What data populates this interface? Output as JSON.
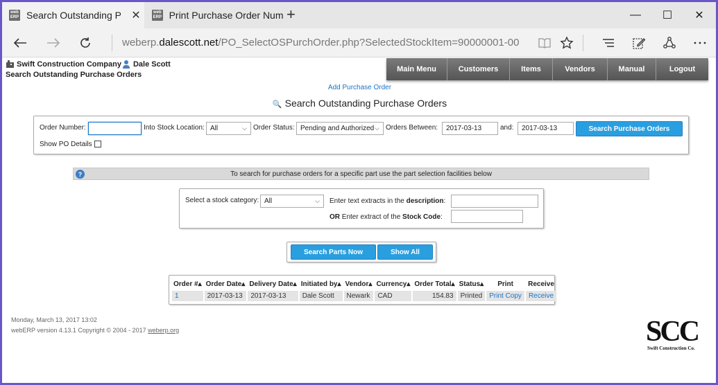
{
  "browser": {
    "tabs": [
      {
        "favicon": "web ERP",
        "title": "Search Outstanding Pur",
        "close": "✕",
        "active": true
      },
      {
        "favicon": "web ERP",
        "title": "Print Purchase Order Numb",
        "close": "",
        "active": false
      }
    ],
    "new_tab": "+",
    "window_controls": {
      "minimize": "—",
      "maximize": "☐",
      "close": "✕"
    },
    "address": {
      "prefix": "weberp.",
      "host": "dalescott.net",
      "path": "/PO_SelectOSPurchOrder.php?SelectedStockItem=90000001-00"
    },
    "nav_icons": {
      "back": "arrow-left-icon",
      "forward": "arrow-right-icon",
      "refresh": "refresh-icon"
    }
  },
  "header": {
    "company": "Swift Construction Company",
    "user": "Dale Scott",
    "subtitle": "Search Outstanding Purchase Orders"
  },
  "menu": [
    "Main Menu",
    "Customers",
    "Items",
    "Vendors",
    "Manual",
    "Logout"
  ],
  "add_po_link": "Add Purchase Order",
  "page_title": "Search Outstanding Purchase Orders",
  "order_form": {
    "order_number_label": "Order Number:",
    "order_number_value": "",
    "location_label": "Into Stock Location:",
    "location_value": "All",
    "status_label": "Order Status:",
    "status_value": "Pending and Authorized",
    "between_label": "Orders Between:",
    "date_from": "2017-03-13",
    "and_label": "and:",
    "date_to": "2017-03-13",
    "search_button": "Search Purchase Orders",
    "show_details_label": "Show PO Details"
  },
  "info_text": "To search for purchase orders for a specific part use the part selection facilities below",
  "part_form": {
    "category_label": "Select a stock category:",
    "category_value": "All",
    "desc_label_pre": "Enter text extracts in the ",
    "desc_label_bold": "description",
    "desc_label_post": ":",
    "or_label": "OR",
    "code_label_pre": " Enter extract of the ",
    "code_label_bold": "Stock Code",
    "code_label_post": ":"
  },
  "buttons": {
    "search_parts": "Search Parts Now",
    "show_all": "Show All"
  },
  "results": {
    "headers": [
      "Order #▴",
      "Order Date▴",
      "Delivery Date▴",
      "Initiated by▴",
      "Vendor▴",
      "Currency▴",
      "Order Total▴",
      "Status▴",
      "Print",
      "Receive"
    ],
    "rows": [
      [
        "1",
        "2017-03-13",
        "2017-03-13",
        "Dale Scott",
        "Newark",
        "CAD",
        "154.83",
        "Printed",
        "Print Copy",
        "Receive"
      ]
    ]
  },
  "footer": {
    "datetime": "Monday, March 13, 2017 13:02",
    "version": "webERP version 4.13.1 Copyright © 2004 - 2017 ",
    "link": "weberp.org"
  },
  "logo": {
    "big": "SCC",
    "small": "Swift Construction Co."
  },
  "colors": {
    "accent": "#2a9fe0",
    "link": "#1a73c7",
    "frame": "#6a55c9",
    "menu": "#6b6b6b"
  }
}
